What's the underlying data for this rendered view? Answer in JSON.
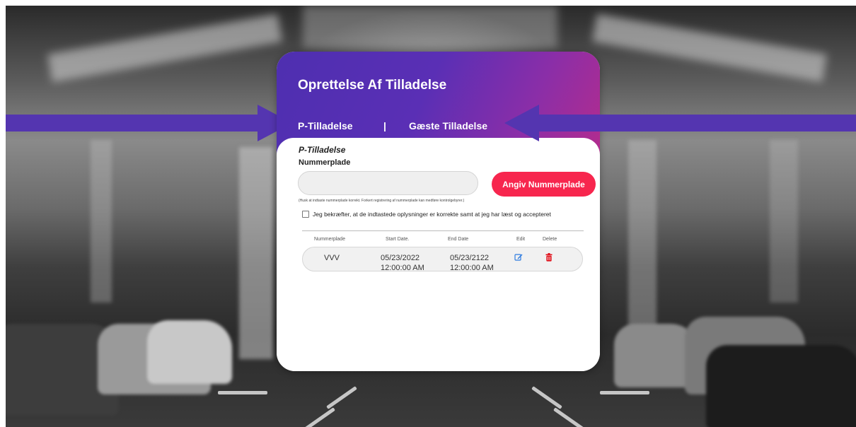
{
  "colors": {
    "header_gradient_start": "#4e2fb0",
    "header_gradient_end": "#b32c8e",
    "accent_button": "#f7264e",
    "arrow": "#5435b0",
    "edit_icon": "#2d7be0",
    "delete_icon": "#e0101a"
  },
  "card": {
    "title": "Oprettelse Af Tilladelse",
    "tabs": [
      "P-Tilladelse",
      "Gæste Tilladelse"
    ],
    "tab_separator": "|"
  },
  "form": {
    "section_title": "P-Tilladelse",
    "plate_label": "Nummerplade",
    "plate_value": "",
    "plate_placeholder": "",
    "submit_label": "Angiv Nummerplade",
    "hint": "(Husk at indtaste nummerplade korrekt. Forkert registrering af nummerplade kan medføre kontrolgebyrer.)",
    "confirm_text": "Jeg bekræfter, at de indtastede oplysninger er korrekte samt at jeg har læst og accepteret"
  },
  "table": {
    "headers": [
      "Nummerplade",
      "Start Date.",
      "End Date",
      "Edit",
      "Delete"
    ],
    "rows": [
      {
        "plate": "VVV",
        "start_date": "05/23/2022",
        "start_time": "12:00:00 AM",
        "end_date": "05/23/2122",
        "end_time": "12:00:00 AM",
        "edit_icon": "edit-icon",
        "delete_icon": "trash-icon"
      }
    ]
  }
}
